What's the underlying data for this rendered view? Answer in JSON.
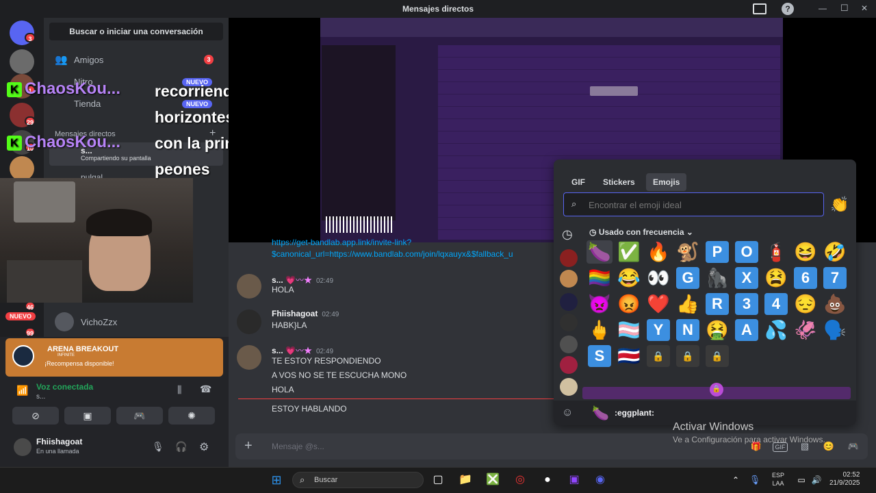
{
  "window": {
    "title": "Mensajes directos",
    "help": "?",
    "min": "—",
    "max": "☐",
    "close": "✕"
  },
  "servers": {
    "badge1": "3",
    "badge2": "1",
    "badge3": "29",
    "badge4": "10",
    "badge5": "46",
    "badge6": "99",
    "new_label": "NUEVO"
  },
  "dm": {
    "search_label": "Buscar o iniciar una conversación",
    "friends_label": "Amigos",
    "friends_count": "3",
    "nitro_label": "Nitro",
    "shop_label": "Tienda",
    "new_badge": "NUEVO",
    "dm_header": "Mensajes directos",
    "add": "+",
    "sharing_user": "s...",
    "sharing_status": "Compartiendo su pantalla",
    "user_pulgal": "pulgal",
    "user_vicho": "VichoZzx"
  },
  "overlay": {
    "chaos_name": "ChaosKou...",
    "kick": "K",
    "lines": [
      "recorriendo los",
      "horizontes",
      "con la princesa hice",
      "peones"
    ]
  },
  "messages": [
    {
      "link1": "https://get-bandlab.app.link/invite-link?",
      "link2": "$canonical_url=https://www.bandlab.com/join/lqxauyx&$fallback_u"
    },
    {
      "author": "s...",
      "badge": "💗〰★",
      "time": "02:49",
      "text": "HOLA"
    },
    {
      "author": "Fhiishagoat",
      "time": "02:49",
      "text": "HABK}LA"
    },
    {
      "author": "s...",
      "badge": "💗〰★",
      "time": "02:49",
      "lines": [
        "TE ESTOY RESPONDIENDO",
        "A VOS NO SE TE ESCUCHA MONO",
        "HOLA"
      ]
    },
    {
      "text": "ESTOY HABLANDO"
    }
  ],
  "picker": {
    "tab_gif": "GIF",
    "tab_stickers": "Stickers",
    "tab_emojis": "Emojis",
    "search_placeholder": "Encontrar el emoji ideal",
    "section": "Usado con frecuencia",
    "footer_emoji": "🍆",
    "footer_name": ":eggplant:",
    "rows": [
      [
        "🍆",
        "✅",
        "🔥",
        "🐒",
        "P",
        "O",
        "🧯",
        "😆",
        "🤣"
      ],
      [
        "🏳️‍🌈",
        "😂",
        "👀",
        "G",
        "🦍",
        "X",
        "😫",
        "6",
        "7"
      ],
      [
        "👿",
        "😡",
        "❤️",
        "👍",
        "R",
        "3",
        "4",
        "😔",
        "💩"
      ],
      [
        "🖕",
        "🏳️‍⚧️",
        "Y",
        "N",
        "🤮",
        "A",
        "💦",
        "🦑",
        "🗣️"
      ],
      [
        "S",
        "🇨🇷",
        "🔒",
        "🔒",
        "🔒"
      ]
    ]
  },
  "promo": {
    "brand": "ARENA BREAKOUT",
    "sub": "INFINITE",
    "text": "¡Recompensa disponible!"
  },
  "voice": {
    "status": "Voz conectada",
    "channel": "s..."
  },
  "user": {
    "name": "Fhiishagoat",
    "status": "En una llamada"
  },
  "input": {
    "placeholder": "Mensaje @s...",
    "plus": "+"
  },
  "watermark": {
    "line1": "Activar Windows",
    "line2": "Ve a Configuración para activar Windows."
  },
  "taskbar": {
    "search": "Buscar",
    "lang1": "ESP",
    "lang2": "LAA",
    "time": "02:52",
    "date": "21/9/2025"
  }
}
